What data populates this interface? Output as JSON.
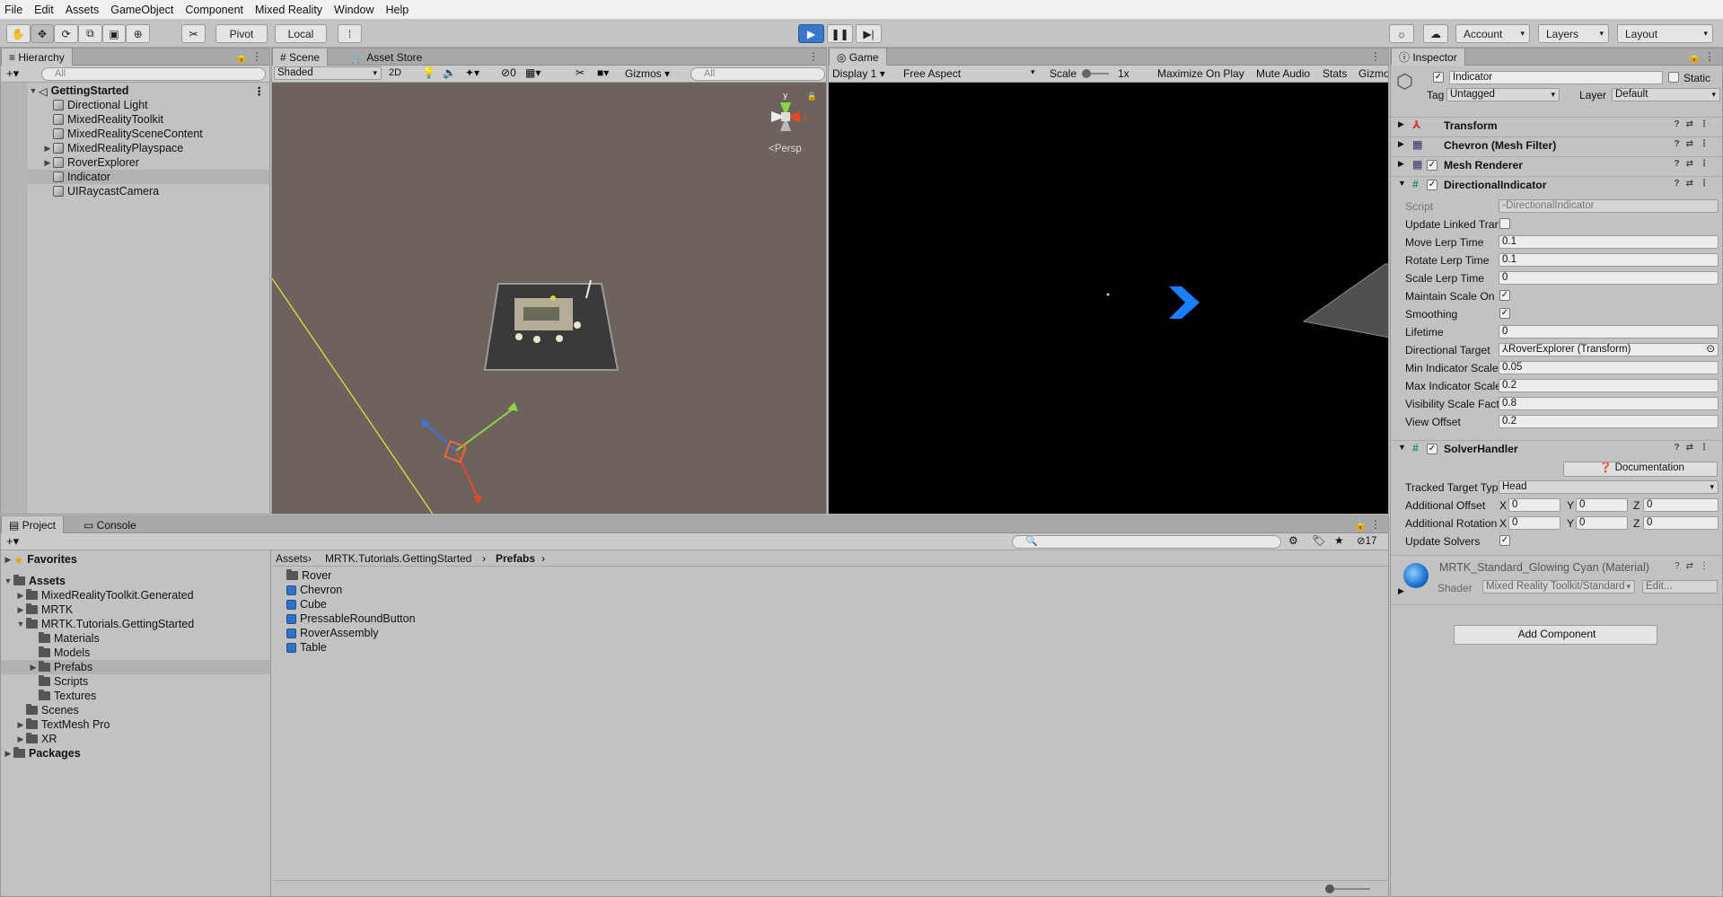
{
  "menu": [
    "File",
    "Edit",
    "Assets",
    "GameObject",
    "Component",
    "Mixed Reality",
    "Window",
    "Help"
  ],
  "toolbar": {
    "pivot": "Pivot",
    "local": "Local",
    "account": "Account",
    "layers": "Layers",
    "layout": "Layout"
  },
  "hierarchy": {
    "tab": "Hierarchy",
    "search_placeholder": "All",
    "scene": "GettingStarted",
    "items": [
      "Directional Light",
      "MixedRealityToolkit",
      "MixedRealitySceneContent",
      "MixedRealityPlayspace",
      "RoverExplorer",
      "Indicator",
      "UIRaycastCamera"
    ]
  },
  "scene_view": {
    "tab": "Scene",
    "tab2": "Asset Store",
    "shading": "Shaded",
    "mode2d": "2D",
    "hidden_count": "0",
    "gizmos": "Gizmos",
    "search_placeholder": "All",
    "persp": "Persp",
    "axis_y": "y",
    "axis_x": "x"
  },
  "game_view": {
    "tab": "Game",
    "display": "Display 1",
    "aspect": "Free Aspect",
    "scale_label": "Scale",
    "scale_value": "1x",
    "maximize": "Maximize On Play",
    "mute": "Mute Audio",
    "stats": "Stats",
    "gizmos": "Gizmo"
  },
  "inspector": {
    "tab": "Inspector",
    "object_name": "Indicator",
    "static_label": "Static",
    "tag_label": "Tag",
    "tag_value": "Untagged",
    "layer_label": "Layer",
    "layer_value": "Default",
    "components": {
      "transform": "Transform",
      "mesh_filter": "Chevron (Mesh Filter)",
      "mesh_renderer": "Mesh Renderer",
      "directional": "DirectionalIndicator",
      "solver": "SolverHandler"
    },
    "directional_fields": [
      {
        "label": "Script",
        "value": "DirectionalIndicator"
      },
      {
        "label": "Update Linked Transfo",
        "value": ""
      },
      {
        "label": "Move Lerp Time",
        "value": "0.1"
      },
      {
        "label": "Rotate Lerp Time",
        "value": "0.1"
      },
      {
        "label": "Scale Lerp Time",
        "value": "0"
      },
      {
        "label": "Maintain Scale On Initi",
        "value": "✓"
      },
      {
        "label": "Smoothing",
        "value": "✓"
      },
      {
        "label": "Lifetime",
        "value": "0"
      },
      {
        "label": "Directional Target",
        "value": "RoverExplorer (Transform)"
      },
      {
        "label": "Min Indicator Scale",
        "value": "0.05"
      },
      {
        "label": "Max Indicator Scale",
        "value": "0.2"
      },
      {
        "label": "Visibility Scale Factor",
        "value": "0.8"
      },
      {
        "label": "View Offset",
        "value": "0.2"
      }
    ],
    "documentation": "Documentation",
    "solver_fields": {
      "tracked_label": "Tracked Target Type",
      "tracked_value": "Head",
      "offset_label": "Additional Offset",
      "rotation_label": "Additional Rotation",
      "update_label": "Update Solvers",
      "x": "X",
      "y": "Y",
      "z": "Z",
      "zero": "0"
    },
    "material": "MRTK_Standard_Glowing Cyan (Material)",
    "shader_label": "Shader",
    "shader_value": "Mixed Reality Toolkit/Standard",
    "edit": "Edit...",
    "add_component": "Add Component"
  },
  "project": {
    "tab": "Project",
    "tab2": "Console",
    "hidden_count": "17",
    "favorites": "Favorites",
    "assets": "Assets",
    "tree": [
      "MixedRealityToolkit.Generated",
      "MRTK",
      "MRTK.Tutorials.GettingStarted",
      "Materials",
      "Models",
      "Prefabs",
      "Scripts",
      "Textures",
      "Scenes",
      "TextMesh Pro",
      "XR"
    ],
    "packages": "Packages",
    "breadcrumb": [
      "Assets",
      "MRTK.Tutorials.GettingStarted",
      "Prefabs"
    ],
    "files": [
      "Rover",
      "Chevron",
      "Cube",
      "PressableRoundButton",
      "RoverAssembly",
      "Table"
    ]
  },
  "colors": {
    "scene_bg": "#6d625c",
    "game_bg": "#000000",
    "play_blue": "#3b77c8",
    "chevron": "#1a7fff"
  }
}
